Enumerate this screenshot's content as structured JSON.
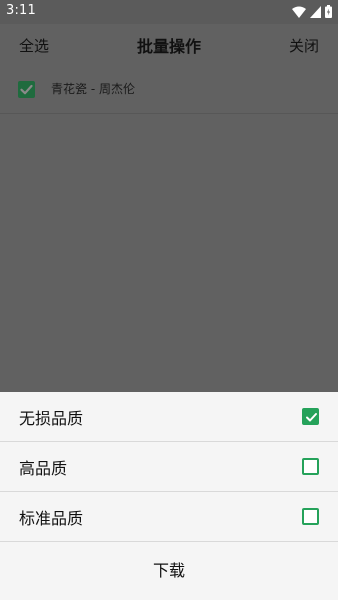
{
  "status_bar": {
    "time": "3:11",
    "icons": [
      "wifi-icon",
      "signal-icon",
      "battery-icon"
    ]
  },
  "app_bar": {
    "select_all_label": "全选",
    "title": "批量操作",
    "close_label": "关闭"
  },
  "list": {
    "items": [
      {
        "label": "青花瓷 - 周杰伦",
        "checked": true
      }
    ]
  },
  "quality_sheet": {
    "options": [
      {
        "label": "无损品质",
        "checked": true
      },
      {
        "label": "高品质",
        "checked": false
      },
      {
        "label": "标准品质",
        "checked": false
      }
    ],
    "download_label": "下载"
  },
  "colors": {
    "accent_green": "#25a25a",
    "scrim": "#616161",
    "sheet_background": "#f5f5f5"
  }
}
